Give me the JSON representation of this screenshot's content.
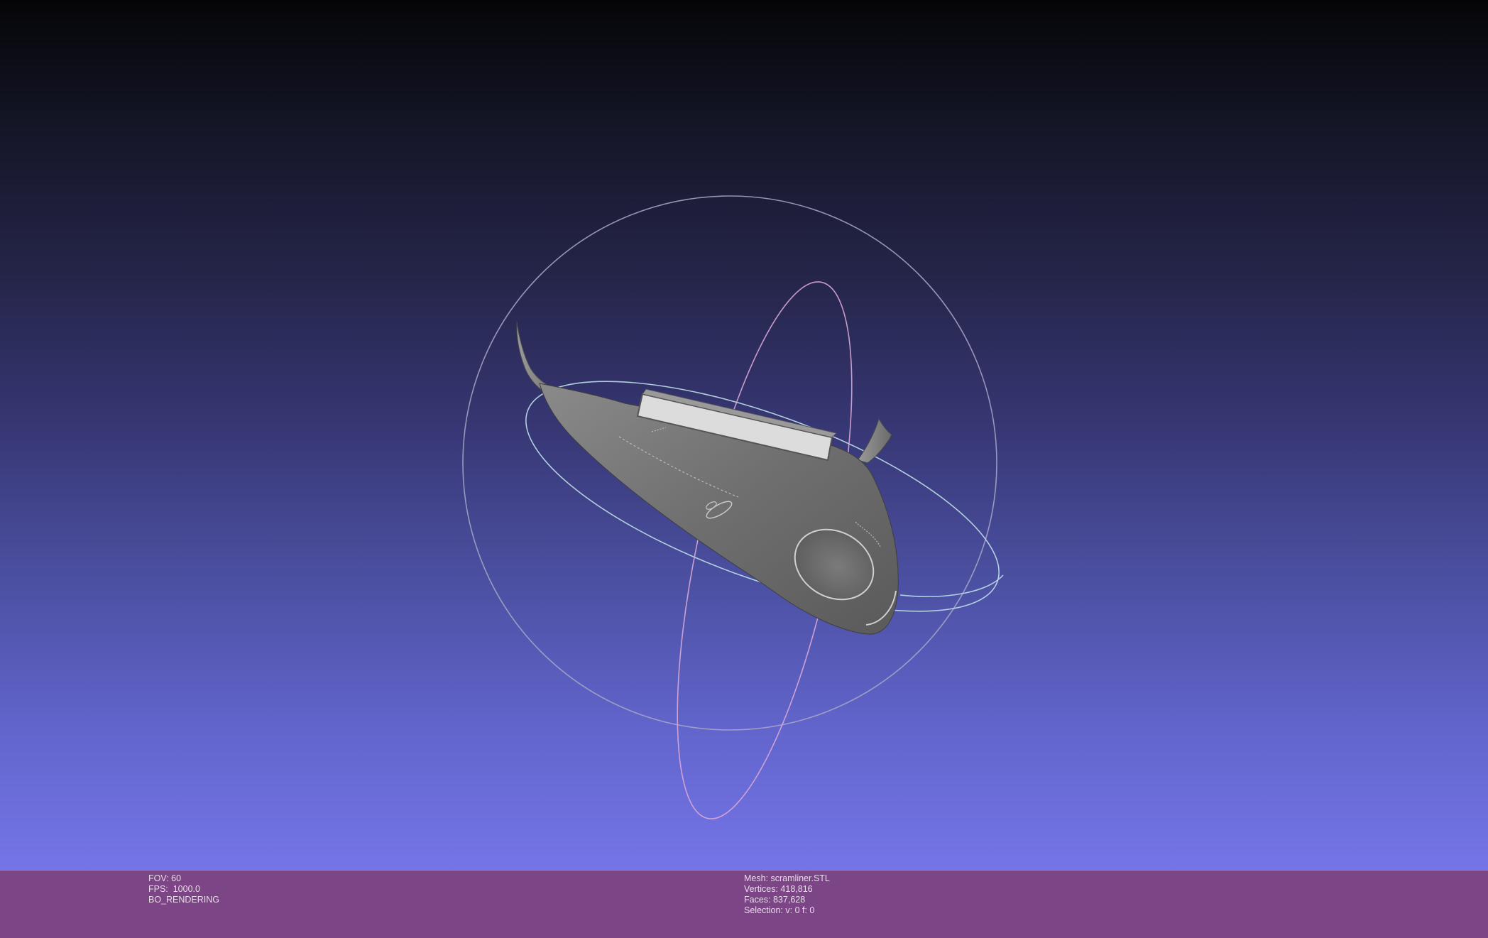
{
  "viewport": {
    "trackball": "trackball-gizmo",
    "model": "scramliner-model"
  },
  "info_left": {
    "fov": "FOV: 60",
    "fps": "FPS:  1000.0",
    "render_mode": "BO_RENDERING"
  },
  "info_right": {
    "mesh": "Mesh: scramliner.STL",
    "vertices": "Vertices: 418,816",
    "faces": "Faces: 837,628",
    "selection": "Selection: v: 0 f: 0"
  },
  "colors": {
    "info_bar": "#7c4585",
    "info_text": "#e8dcea",
    "gradient_top": "#050508",
    "gradient_bottom": "#7575e8",
    "model_body": "#6f6f6f",
    "model_window": "#dcdcdc"
  }
}
